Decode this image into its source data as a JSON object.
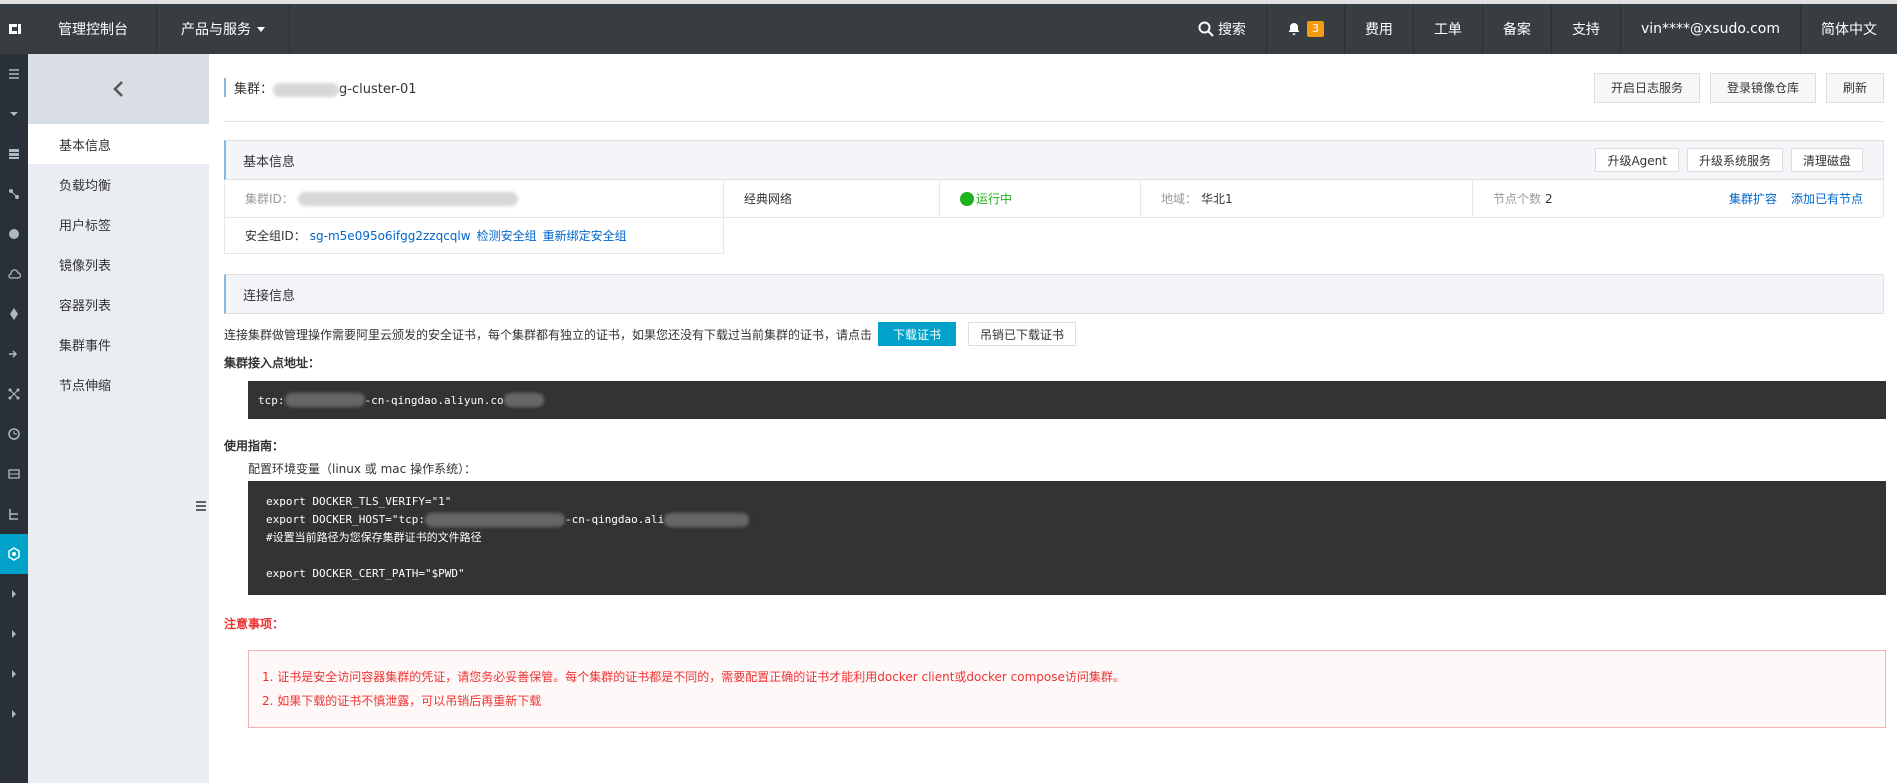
{
  "topbar": {
    "console": "管理控制台",
    "products": "产品与服务",
    "search": "搜索",
    "notifications": "3",
    "billing": "费用",
    "tickets": "工单",
    "filing": "备案",
    "support": "支持",
    "account": "vin****@xsudo.com",
    "language": "简体中文"
  },
  "sidebar": {
    "items": [
      {
        "label": "基本信息"
      },
      {
        "label": "负载均衡"
      },
      {
        "label": "用户标签"
      },
      {
        "label": "镜像列表"
      },
      {
        "label": "容器列表"
      },
      {
        "label": "集群事件"
      },
      {
        "label": "节点伸缩"
      }
    ]
  },
  "header": {
    "title_prefix": "集群：",
    "title_suffix": "g-cluster-01",
    "btn_log": "开启日志服务",
    "btn_registry": "登录镜像仓库",
    "btn_refresh": "刷新"
  },
  "basic": {
    "title": "基本信息",
    "btn_agent": "升级Agent",
    "btn_system": "升级系统服务",
    "btn_disk": "清理磁盘",
    "cluster_id_label": "集群ID：",
    "network": "经典网络",
    "status": "运行中",
    "region_label": "地域：",
    "region": "华北1",
    "nodes_label": "节点个数",
    "nodes": "2",
    "scale": "集群扩容",
    "add_node": "添加已有节点",
    "sg_label": "安全组ID：",
    "sg_id": "sg-m5e095o6ifgg2zzqcqlw",
    "sg_check": "检测安全组",
    "sg_rebind": "重新绑定安全组"
  },
  "connection": {
    "title": "连接信息",
    "desc": "连接集群做管理操作需要阿里云颁发的安全证书，每个集群都有独立的证书，如果您还没有下载过当前集群的证书，请点击",
    "btn_download": "下载证书",
    "btn_revoke": "吊销已下载证书",
    "endpoint_label": "集群接入点地址：",
    "endpoint_prefix": "tcp:",
    "endpoint_mid": "-cn-qingdao.aliyun.co",
    "guide_label": "使用指南：",
    "env_label": "配置环境变量（linux 或 mac 操作系统）：",
    "line1": "export DOCKER_TLS_VERIFY=\"1\"",
    "line2_prefix": "export DOCKER_HOST=\"tcp:",
    "line2_mid": "-cn-qingdao.ali",
    "line3": "#设置当前路径为您保存集群证书的文件路径",
    "line4": "export DOCKER_CERT_PATH=\"$PWD\""
  },
  "notice": {
    "title": "注意事项：",
    "item1": "1. 证书是安全访问容器集群的凭证，请您务必妥善保管。每个集群的证书都是不同的，需要配置正确的证书才能利用docker client或docker compose访问集群。",
    "item2": "2. 如果下载的证书不慎泄露，可以吊销后再重新下载"
  }
}
